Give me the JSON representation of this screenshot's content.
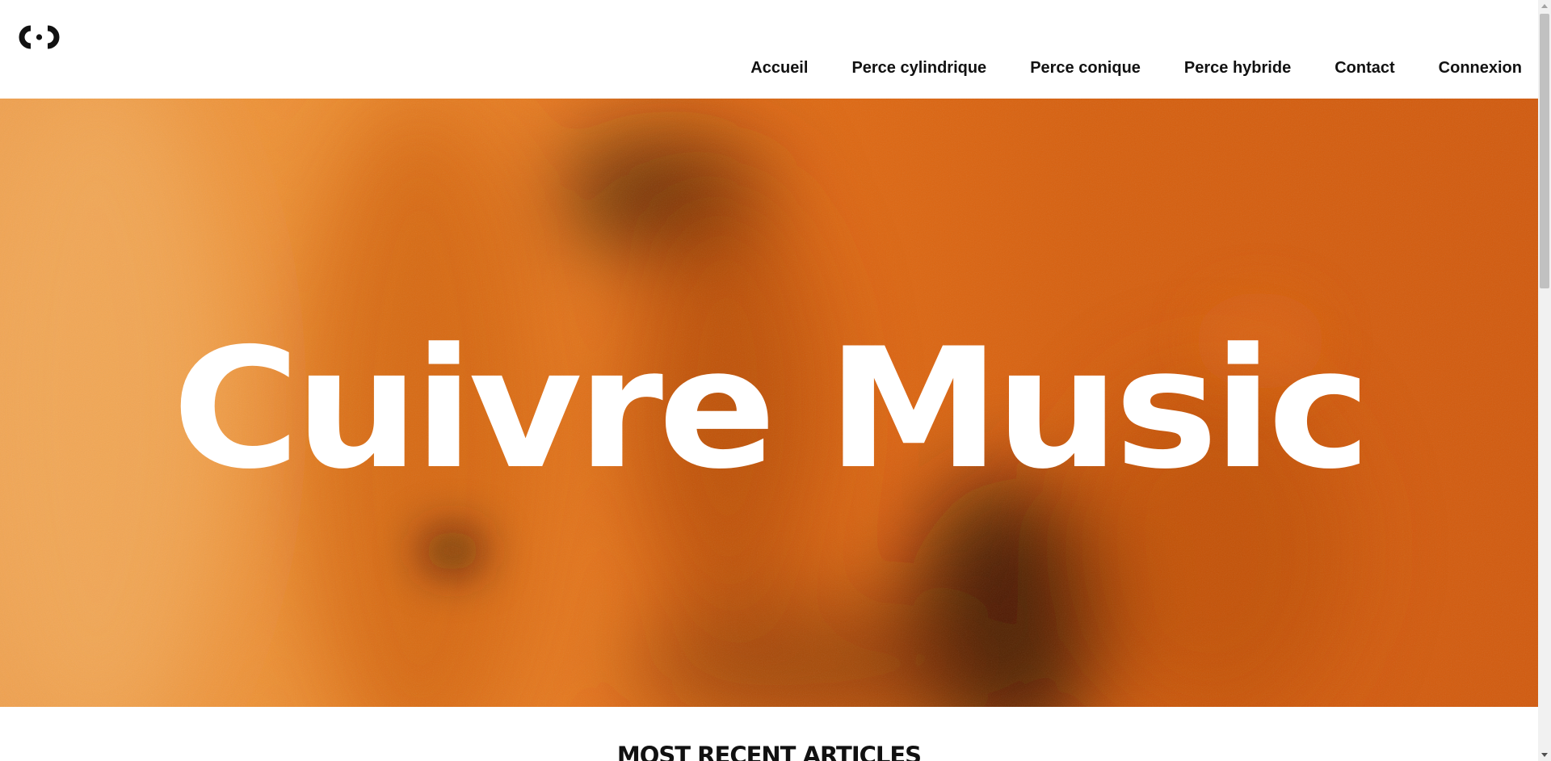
{
  "brand": {
    "logo_icon": "cuivre-music-logo-icon"
  },
  "nav": {
    "items": [
      {
        "label": "Accueil"
      },
      {
        "label": "Perce cylindrique"
      },
      {
        "label": "Perce conique"
      },
      {
        "label": "Perce hybride"
      },
      {
        "label": "Contact"
      },
      {
        "label": "Connexion"
      }
    ]
  },
  "hero": {
    "title": "Cuivre Music",
    "title_color": "#ffffff",
    "background_colors": [
      "#f3a04a",
      "#e06a10",
      "#c95108",
      "#3a1a0a"
    ]
  },
  "section": {
    "title": "MOST RECENT ARTICLES"
  }
}
